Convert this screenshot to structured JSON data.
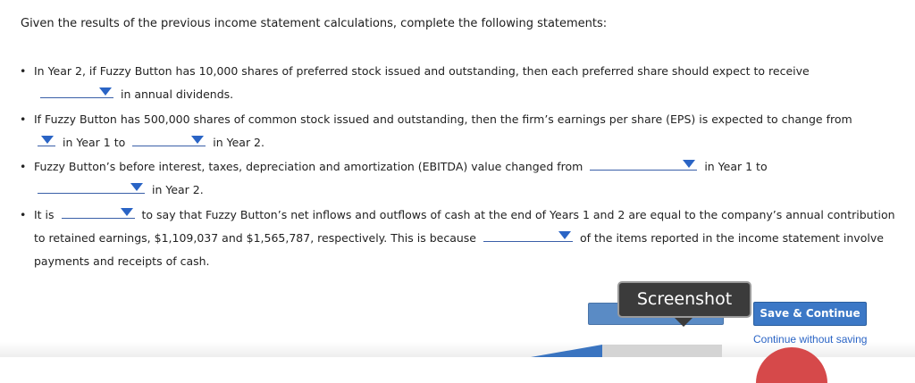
{
  "intro": "Given the results of the previous income statement calculations, complete the following statements:",
  "items": [
    {
      "text1": "In Year 2, if Fuzzy Button has 10,000 shares of preferred stock issued and outstanding, then each preferred share should expect to receive",
      "text2": "in annual dividends."
    },
    {
      "text1": "If Fuzzy Button has 500,000 shares of common stock issued and outstanding, then the firm’s earnings per share (EPS) is expected to change from",
      "text2": "in Year 1 to",
      "text3": "in Year 2."
    },
    {
      "text1": "Fuzzy Button’s before interest, taxes, depreciation and amortization (EBITDA) value changed from",
      "text2": "in Year 1 to",
      "text3": "in Year 2."
    },
    {
      "text1": "It is",
      "text2": "to say that Fuzzy Button’s net inflows and outflows of cash at the end of Years 1 and 2 are equal to the company’s annual contribution to retained earnings, $1,109,037 and $1,565,787, respectively. This is because",
      "text3": "of the items reported in the income statement involve payments and receipts of cash."
    }
  ],
  "bullet": "•",
  "tooltip": "Screenshot",
  "buttons": {
    "save": "Save & Continue",
    "continue_without_saving": "Continue without saving"
  },
  "colors": {
    "accent": "#2a64c5",
    "save_button": "#3c78c6"
  },
  "icons": {
    "dropdown": "triangle-down-icon"
  }
}
